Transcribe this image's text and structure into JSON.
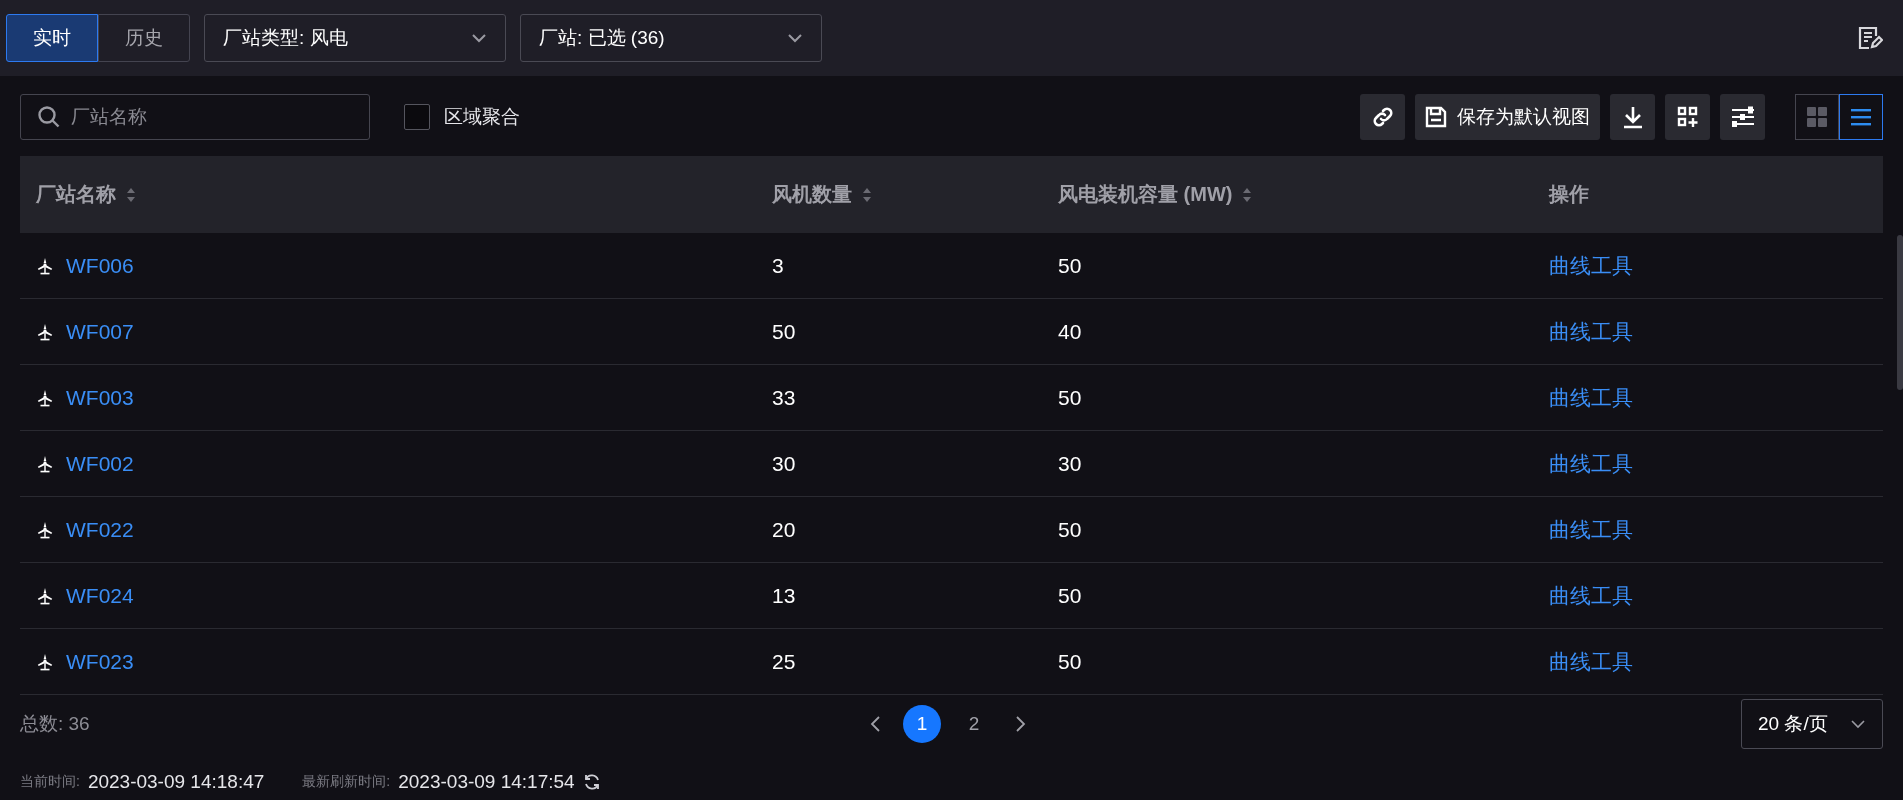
{
  "tabs": [
    {
      "label": "实时",
      "selected": true
    },
    {
      "label": "历史",
      "selected": false
    }
  ],
  "filters": [
    {
      "label": "厂站类型: 风电"
    },
    {
      "label": "厂站: 已选 (36)"
    }
  ],
  "search": {
    "placeholder": "厂站名称"
  },
  "aggregate": {
    "label": "区域聚合",
    "checked": false
  },
  "save_button": {
    "label": "保存为默认视图"
  },
  "view_toggles": [
    {
      "kind": "grid",
      "selected": false
    },
    {
      "kind": "list",
      "selected": true
    }
  ],
  "table": {
    "columns": [
      {
        "label": "厂站名称",
        "sortable": true
      },
      {
        "label": "风机数量",
        "sortable": true
      },
      {
        "label": "风电装机容量 (MW)",
        "sortable": true
      },
      {
        "label": "操作",
        "sortable": false
      }
    ],
    "rows": [
      {
        "name": "WF006",
        "count": "3",
        "capacity": "50",
        "action": "曲线工具"
      },
      {
        "name": "WF007",
        "count": "50",
        "capacity": "40",
        "action": "曲线工具"
      },
      {
        "name": "WF003",
        "count": "33",
        "capacity": "50",
        "action": "曲线工具"
      },
      {
        "name": "WF002",
        "count": "30",
        "capacity": "30",
        "action": "曲线工具"
      },
      {
        "name": "WF022",
        "count": "20",
        "capacity": "50",
        "action": "曲线工具"
      },
      {
        "name": "WF024",
        "count": "13",
        "capacity": "50",
        "action": "曲线工具"
      },
      {
        "name": "WF023",
        "count": "25",
        "capacity": "50",
        "action": "曲线工具"
      }
    ]
  },
  "total": "总数: 36",
  "pages": [
    {
      "label": "1",
      "selected": true
    },
    {
      "label": "2",
      "selected": false
    }
  ],
  "page_size": "20 条/页",
  "status": {
    "current_label": "当前时间:",
    "current": "2023-03-09 14:18:47",
    "refresh_label": "最新刷新时间:",
    "refresh": "2023-03-09 14:17:54"
  }
}
